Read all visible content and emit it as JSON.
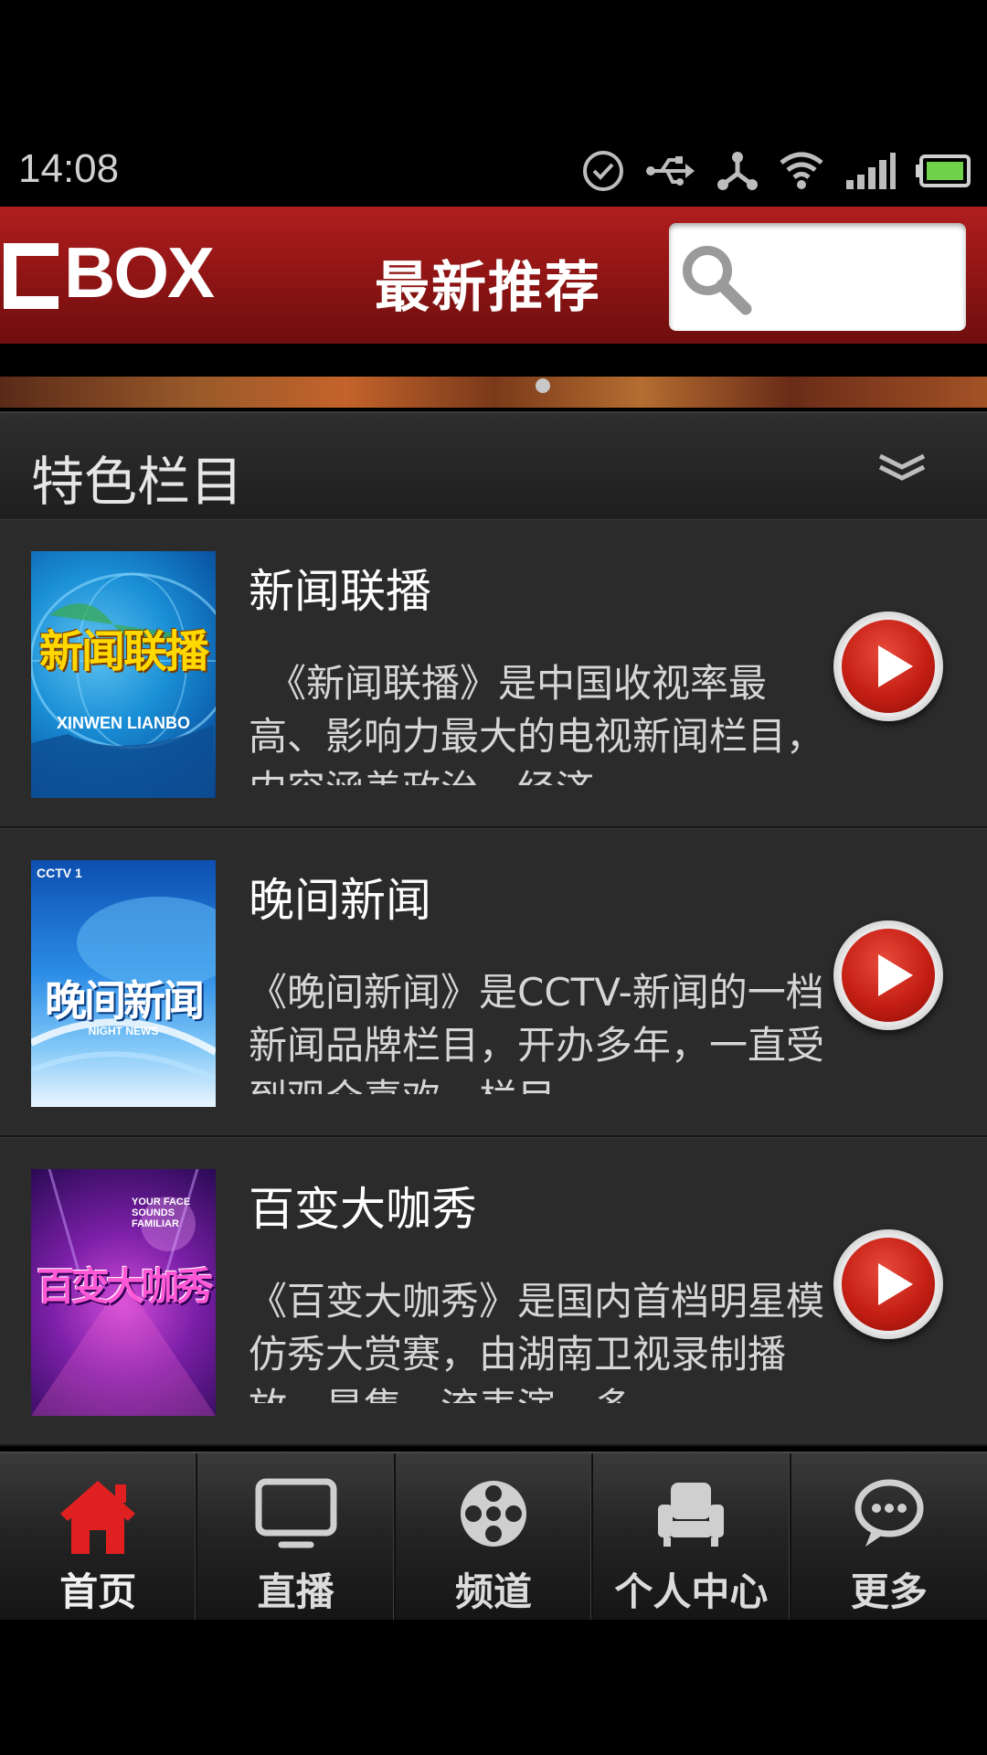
{
  "status_bar": {
    "time": "14:08"
  },
  "header": {
    "logo_text": "BOX",
    "title": "最新推荐",
    "search_placeholder": ""
  },
  "section": {
    "title": "特色栏目"
  },
  "items": [
    {
      "title": "新闻联播",
      "description": "　《新闻联播》是中国收视率最高、影响力最大的电视新闻栏目，内容涵盖政治、经济",
      "thumb_text_main": "新闻联播",
      "thumb_text_sub": "XINWEN LIANBO"
    },
    {
      "title": "晚间新闻",
      "description": "《晚间新闻》是CCTV-新闻的一档新闻品牌栏目，开办多年，一直受到观众喜欢，栏目",
      "thumb_text_main": "晚间新闻",
      "thumb_text_sub": "NIGHT NEWS",
      "thumb_badge": "CCTV 1"
    },
    {
      "title": "百变大咖秀",
      "description": "《百变大咖秀》是国内首档明星模仿秀大赏赛，由湖南卫视录制播放，是集一流表演、多",
      "thumb_text_main": "百变大咖秀",
      "thumb_text_sub": "YOUR FACE SOUNDS FAMILIAR"
    }
  ],
  "bottom_nav": [
    {
      "label": "首页",
      "icon": "home-icon",
      "active": true
    },
    {
      "label": "直播",
      "icon": "tv-icon",
      "active": false
    },
    {
      "label": "频道",
      "icon": "film-reel-icon",
      "active": false
    },
    {
      "label": "个人中心",
      "icon": "armchair-icon",
      "active": false
    },
    {
      "label": "更多",
      "icon": "chat-bubble-icon",
      "active": false
    }
  ],
  "colors": {
    "header_red": "#9a1818",
    "active_nav": "#e02020",
    "play_red": "#c51f14"
  }
}
